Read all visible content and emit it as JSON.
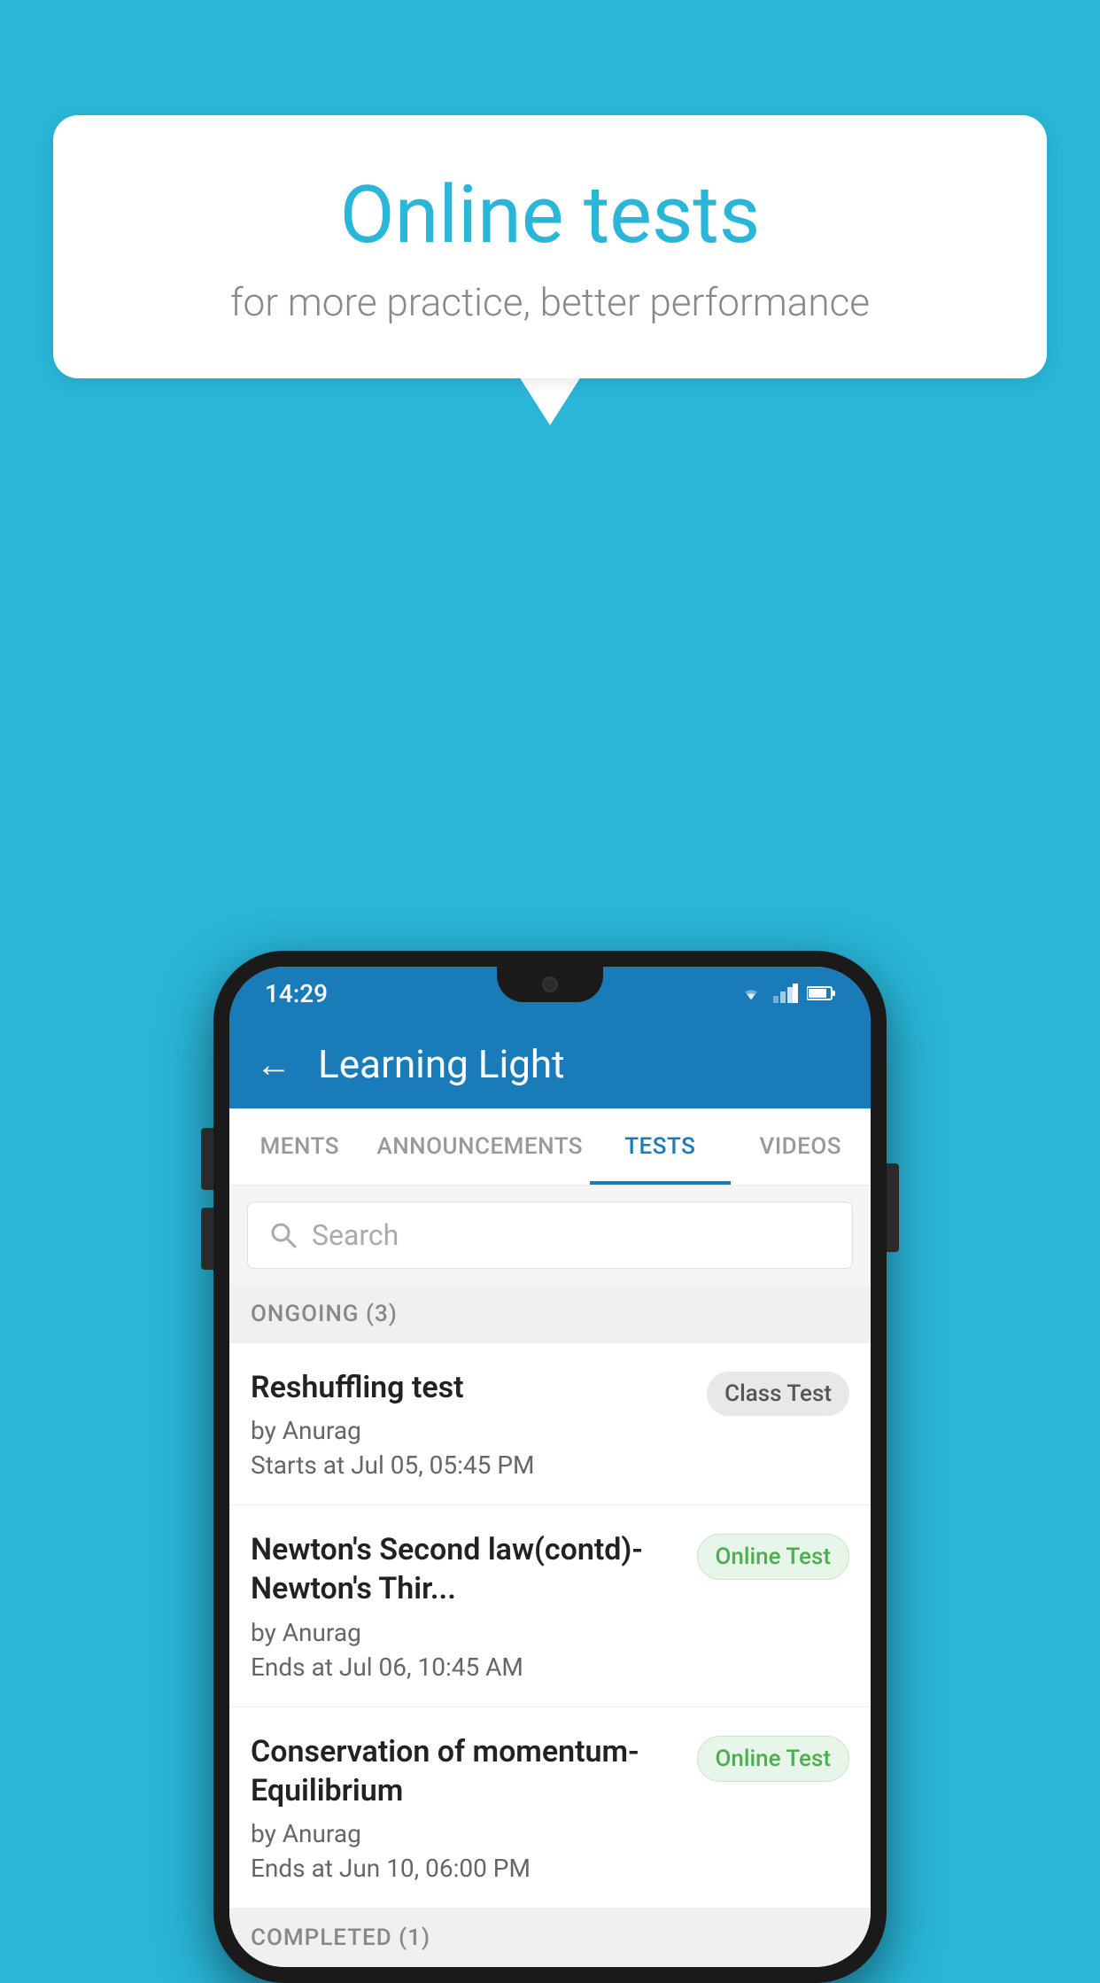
{
  "background_color": "#29b6d8",
  "speech_bubble": {
    "title": "Online tests",
    "subtitle": "for more practice, better performance"
  },
  "phone": {
    "status_bar": {
      "time": "14:29",
      "icons": [
        "wifi",
        "signal",
        "battery"
      ]
    },
    "app_bar": {
      "title": "Learning Light",
      "back_label": "←"
    },
    "tabs": [
      {
        "label": "MENTS",
        "active": false
      },
      {
        "label": "ANNOUNCEMENTS",
        "active": false
      },
      {
        "label": "TESTS",
        "active": true
      },
      {
        "label": "VIDEOS",
        "active": false
      }
    ],
    "search": {
      "placeholder": "Search"
    },
    "sections": [
      {
        "header": "ONGOING (3)",
        "items": [
          {
            "name": "Reshuffling test",
            "author": "by Anurag",
            "date": "Starts at  Jul 05, 05:45 PM",
            "badge": "Class Test",
            "badge_type": "class"
          },
          {
            "name": "Newton's Second law(contd)-Newton's Thir...",
            "author": "by Anurag",
            "date": "Ends at  Jul 06, 10:45 AM",
            "badge": "Online Test",
            "badge_type": "online"
          },
          {
            "name": "Conservation of momentum-Equilibrium",
            "author": "by Anurag",
            "date": "Ends at  Jun 10, 06:00 PM",
            "badge": "Online Test",
            "badge_type": "online"
          }
        ]
      }
    ],
    "completed_header": "COMPLETED (1)"
  }
}
